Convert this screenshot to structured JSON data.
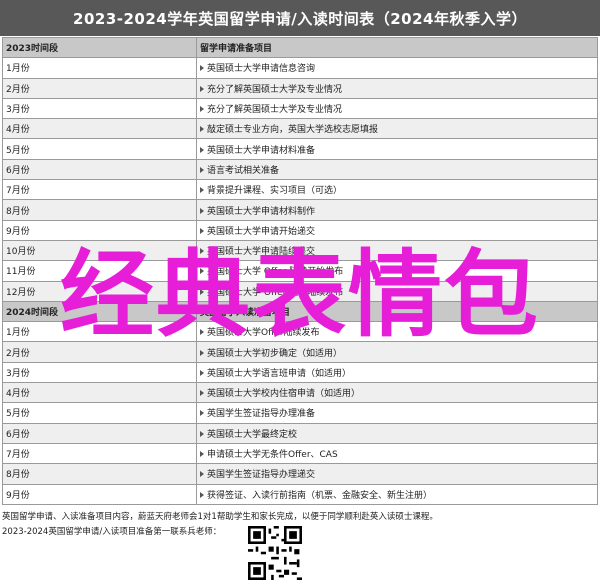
{
  "title": "2023-2024学年英国留学申请/入读时间表（2024年秋季入学）",
  "table": {
    "header": [
      "2023时间段",
      "留学申请准备项目"
    ],
    "rows": [
      [
        "1月份",
        "英国硕士大学申请信息咨询"
      ],
      [
        "2月份",
        "充分了解英国硕士大学及专业情况"
      ],
      [
        "3月份",
        "充分了解英国硕士大学及专业情况"
      ],
      [
        "4月份",
        "敲定硕士专业方向，英国大学选校志愿填报"
      ],
      [
        "5月份",
        "英国硕士大学申请材料准备"
      ],
      [
        "6月份",
        "语言考试相关准备"
      ],
      [
        "7月份",
        "背景提升课程、实习项目（可选）"
      ],
      [
        "8月份",
        "英国硕士大学申请材料制作"
      ],
      [
        "9月份",
        "英国硕士大学申请开始递交"
      ],
      [
        "10月份",
        "英国硕士大学申请陆续递交"
      ],
      [
        "11月份",
        "英国硕士大学 Offer 陆续开始发布"
      ],
      [
        "12月份",
        "英国硕士大学 Offer 陆续陆续发布"
      ]
    ],
    "header2": [
      "2024时间段",
      "英国留学入读准备项目"
    ],
    "rows2": [
      [
        "1月份",
        "英国硕士大学Offer陆续发布"
      ],
      [
        "2月份",
        "英国硕士大学初步确定（如适用）"
      ],
      [
        "3月份",
        "英国硕士大学语言班申请（如适用）"
      ],
      [
        "4月份",
        "英国硕士大学校内住宿申请（如适用）"
      ],
      [
        "5月份",
        "英国学生签证指导办理准备"
      ],
      [
        "6月份",
        "英国硕士大学最终定校"
      ],
      [
        "7月份",
        "申请硕士大学无条件Offer、CAS"
      ],
      [
        "8月份",
        "英国学生签证指导办理递交"
      ],
      [
        "9月份",
        "获得签证、入读行前指南（机票、金融安全、新生注册）"
      ]
    ]
  },
  "footer": {
    "line1": "英国留学申请、入读准备项目内容，蔚蓝天府老师会1对1帮助学生和家长完成，以便于同学顺利赴英入读硕士课程。",
    "line2": "2023-2024英国留学申请/入读项目准备第一联系兵老师："
  },
  "overlay_text": "经典表情包"
}
